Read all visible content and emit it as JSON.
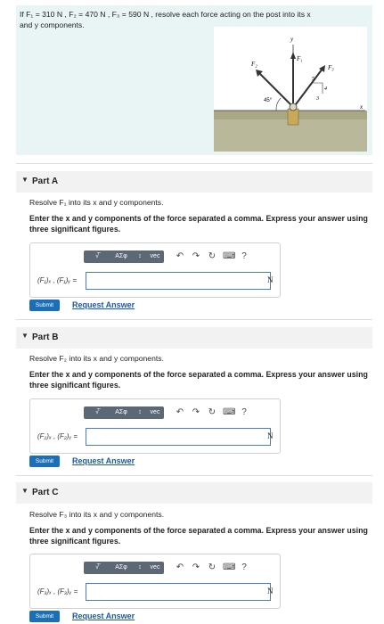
{
  "problem": {
    "text_line1": "If F₁ = 310 N , F₂ = 470 N , F₃ = 590 N , resolve each force acting on the post into its x",
    "text_line2": "and y components.",
    "figure": {
      "label_y": "y",
      "label_x": "x",
      "label_f1": "F₁",
      "label_f2": "F₂",
      "label_f3": "F₃",
      "angle": "45°",
      "ratio_5": "5",
      "ratio_4": "4",
      "ratio_3": "3"
    }
  },
  "toolbar": {
    "radical": "√̅",
    "greek": "AΣφ",
    "updown": "↕",
    "vec": "vec",
    "undo": "↶",
    "redo": "↷",
    "reset": "↻",
    "keyboard": "⌨",
    "help": "?"
  },
  "parts": [
    {
      "title": "Part A",
      "resolve": "Resolve F₁ into its x and y components.",
      "instructions": "Enter the x and y components of the force separated a comma. Express your answer using three significant figures.",
      "answer_label": "(F₁)ₓ , (F₁)ᵧ =",
      "answer_value": "",
      "unit": "N",
      "submit": "Submit",
      "request": "Request Answer"
    },
    {
      "title": "Part B",
      "resolve": "Resolve F₂ into its x and y components.",
      "instructions": "Enter the x and y components of the force separated a comma. Express your answer using three significant figures.",
      "answer_label": "(F₂)ₓ , (F₂)ᵧ =",
      "answer_value": "",
      "unit": "N",
      "submit": "Submit",
      "request": "Request Answer"
    },
    {
      "title": "Part C",
      "resolve": "Resolve F₃ into its x and y components.",
      "instructions": "Enter the x and y components of the force separated a comma. Express your answer using three significant figures.",
      "answer_label": "(F₃)ₓ , (F₃)ᵧ =",
      "answer_value": "",
      "unit": "N",
      "submit": "Submit",
      "request": "Request Answer"
    }
  ]
}
